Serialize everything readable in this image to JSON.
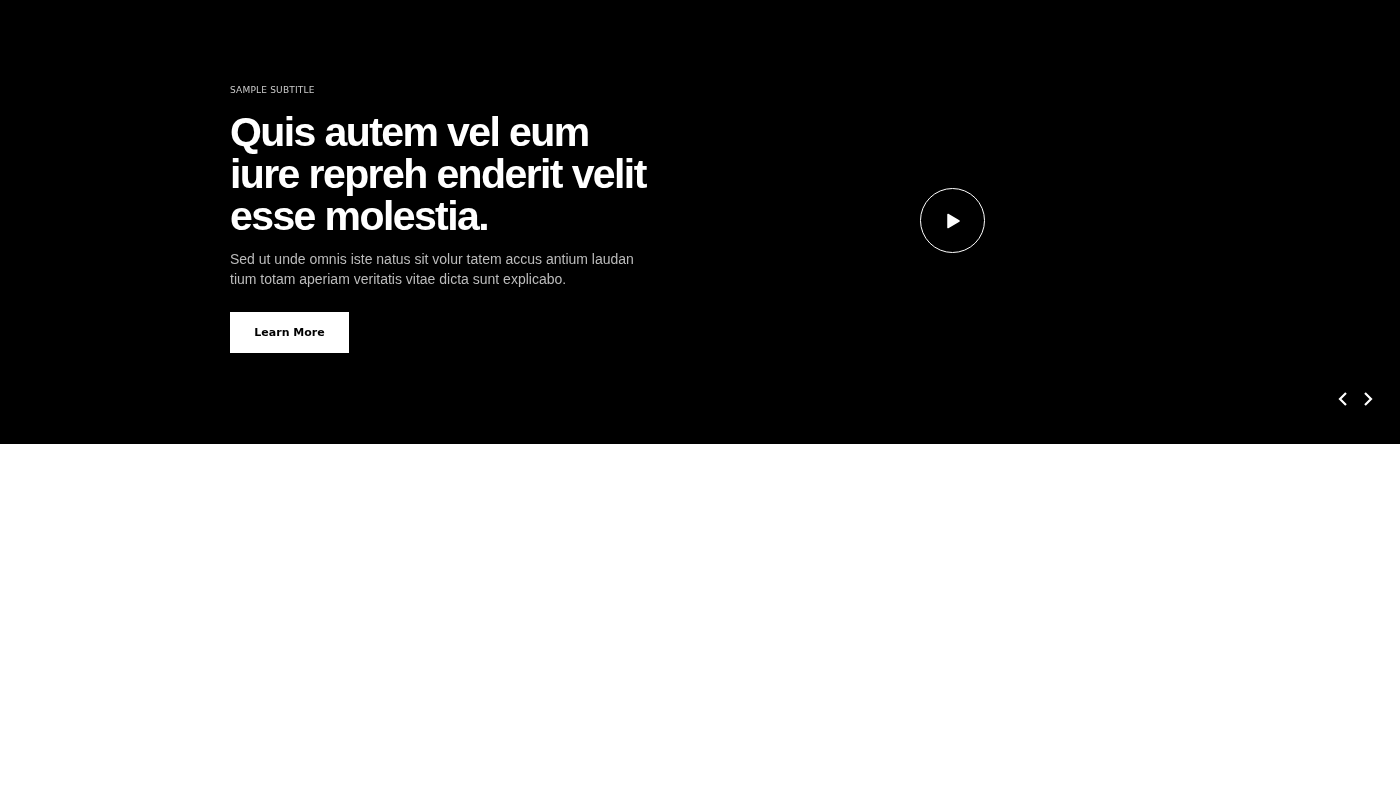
{
  "hero": {
    "subtitle": "SAMPLE SUBTITLE",
    "heading": "Quis autem vel eum\niure repreh enderit velit\nesse molestia.",
    "text": "Sed ut unde omnis iste natus sit volur tatem accus antium laudan tium totam aperiam veritatis vitae dicta sunt explicabo.",
    "button": "Learn More"
  }
}
